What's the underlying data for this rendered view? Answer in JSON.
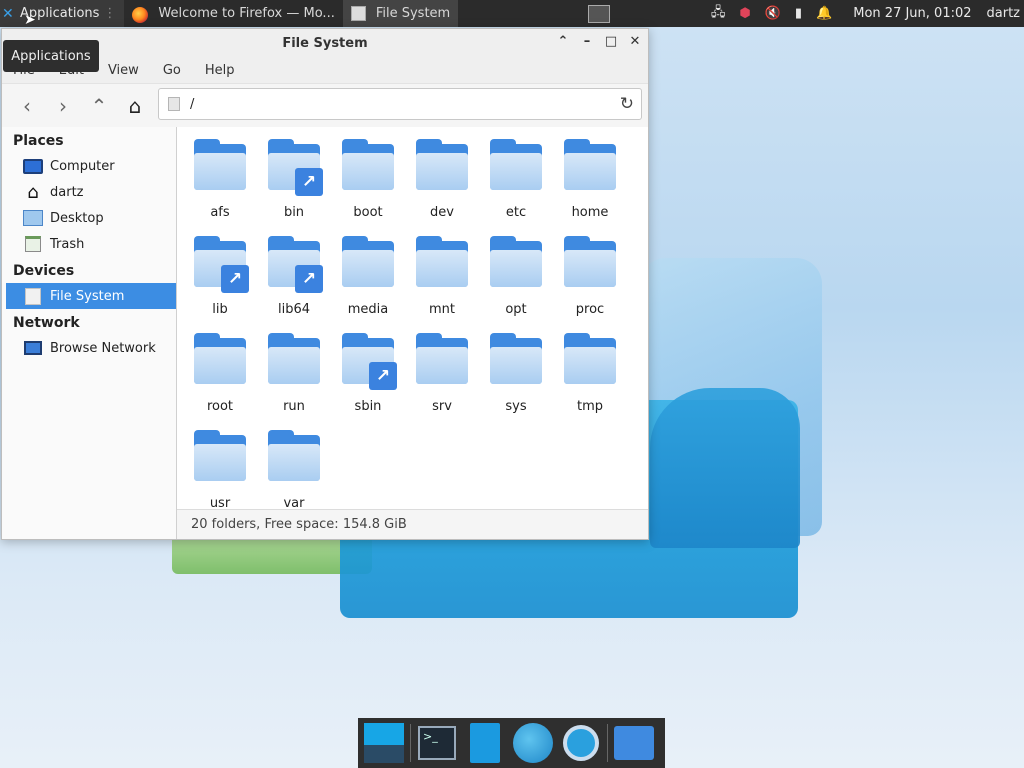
{
  "panel": {
    "applications_label": "Applications",
    "tasks": [
      {
        "label": "Welcome to Firefox — Mo..."
      },
      {
        "label": "File System"
      }
    ],
    "clock": "Mon 27 Jun, 01:02",
    "user": "dartz"
  },
  "tooltip": "Applications",
  "window": {
    "title": "File System",
    "menu": [
      "File",
      "Edit",
      "View",
      "Go",
      "Help"
    ],
    "location": "/",
    "sidebar": {
      "places_heading": "Places",
      "places": [
        "Computer",
        "dartz",
        "Desktop",
        "Trash"
      ],
      "devices_heading": "Devices",
      "devices": [
        "File System"
      ],
      "network_heading": "Network",
      "network": [
        "Browse Network"
      ]
    },
    "folders": [
      {
        "name": "afs",
        "link": false
      },
      {
        "name": "bin",
        "link": true
      },
      {
        "name": "boot",
        "link": false
      },
      {
        "name": "dev",
        "link": false
      },
      {
        "name": "etc",
        "link": false
      },
      {
        "name": "home",
        "link": false
      },
      {
        "name": "lib",
        "link": true
      },
      {
        "name": "lib64",
        "link": true
      },
      {
        "name": "media",
        "link": false
      },
      {
        "name": "mnt",
        "link": false
      },
      {
        "name": "opt",
        "link": false
      },
      {
        "name": "proc",
        "link": false
      },
      {
        "name": "root",
        "link": false
      },
      {
        "name": "run",
        "link": false
      },
      {
        "name": "sbin",
        "link": true
      },
      {
        "name": "srv",
        "link": false
      },
      {
        "name": "sys",
        "link": false
      },
      {
        "name": "tmp",
        "link": false
      },
      {
        "name": "usr",
        "link": false
      },
      {
        "name": "var",
        "link": false
      }
    ],
    "status": "20 folders, Free space: 154.8 GiB"
  },
  "colors": {
    "accent": "#3c8de3",
    "folder": "#3f8ae0",
    "panel": "#2b2b2b"
  }
}
